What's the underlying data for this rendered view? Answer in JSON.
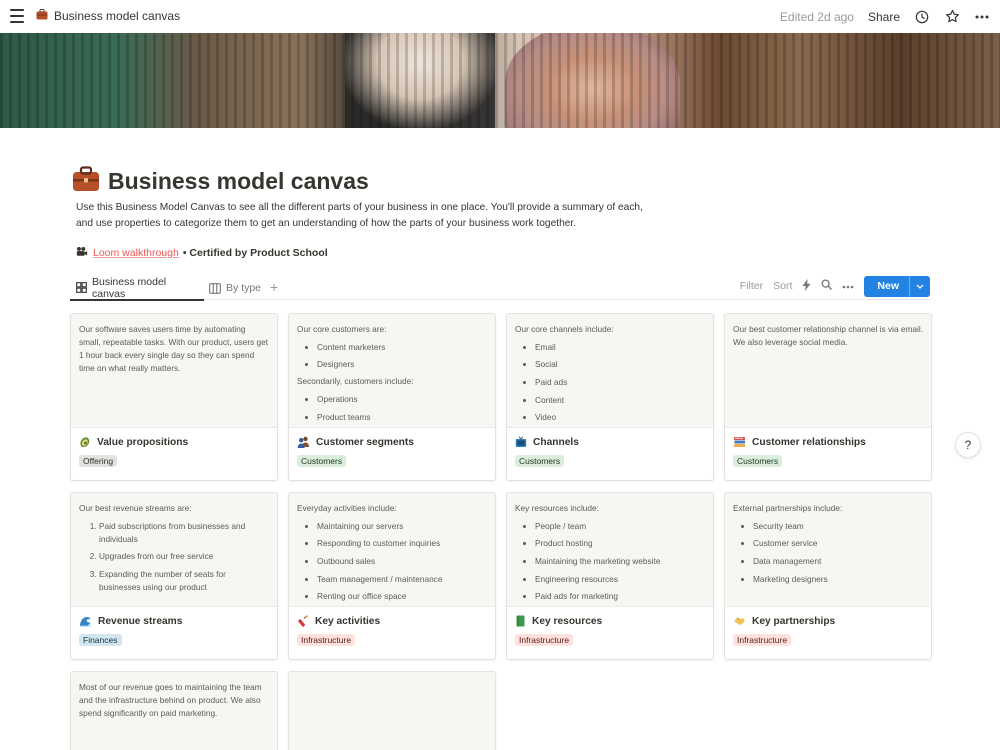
{
  "topbar": {
    "breadcrumb": "Business model canvas",
    "edited": "Edited 2d ago",
    "share": "Share"
  },
  "page": {
    "title": "Business model canvas",
    "description": "Use this Business Model Canvas to see all the different parts of your business in one place. You'll provide a summary of each, and use properties to categorize them to get an understanding of how the parts of your business work together.",
    "loom_link": "Loom walkthrough",
    "certified": "• Certified by Product School"
  },
  "views": {
    "tabs": [
      "Business model canvas",
      "By type"
    ],
    "filter": "Filter",
    "sort": "Sort",
    "new": "New"
  },
  "cards": [
    {
      "title": "Value propositions",
      "icon": "avocado-icon",
      "tag": "Offering",
      "tag_color": "gray",
      "preview": [
        {
          "type": "p",
          "text": "Our software saves users time by automating small, repeatable tasks. With our product, users get 1 hour back every single day so they can spend time on what really matters."
        }
      ]
    },
    {
      "title": "Customer segments",
      "icon": "people-icon",
      "tag": "Customers",
      "tag_color": "green",
      "preview": [
        {
          "type": "p",
          "text": "Our core customers are:"
        },
        {
          "type": "ul",
          "items": [
            "Content marketers",
            "Designers"
          ]
        },
        {
          "type": "p",
          "text": "Secondarily, customers include:"
        },
        {
          "type": "ul",
          "items": [
            "Operations",
            "Product teams"
          ]
        }
      ]
    },
    {
      "title": "Channels",
      "icon": "tv-icon",
      "tag": "Customers",
      "tag_color": "green",
      "preview": [
        {
          "type": "p",
          "text": "Our core channels include:"
        },
        {
          "type": "ul",
          "items": [
            "Email",
            "Social",
            "Paid ads",
            "Content",
            "Video"
          ]
        }
      ]
    },
    {
      "title": "Customer relationships",
      "icon": "books-icon",
      "tag": "Customers",
      "tag_color": "green",
      "preview": [
        {
          "type": "p",
          "text": "Our best customer relationship channel is via email. We also leverage social media."
        }
      ]
    },
    {
      "title": "Revenue streams",
      "icon": "wave-icon",
      "tag": "Finances",
      "tag_color": "blue",
      "preview": [
        {
          "type": "p",
          "text": "Our best revenue streams are:"
        },
        {
          "type": "ol",
          "items": [
            "Paid subscriptions from businesses and individuals",
            "Upgrades from our free service",
            "Expanding the number of seats for businesses using our product"
          ]
        }
      ]
    },
    {
      "title": "Key activities",
      "icon": "firecracker-icon",
      "tag": "Infrastructure",
      "tag_color": "red",
      "preview": [
        {
          "type": "p",
          "text": "Everyday activities include:"
        },
        {
          "type": "ul",
          "items": [
            "Maintaining our servers",
            "Responding to customer inquiries",
            "Outbound sales",
            "Team management / maintenance",
            "Renting our office space"
          ]
        }
      ]
    },
    {
      "title": "Key resources",
      "icon": "book-icon",
      "tag": "Infrastructure",
      "tag_color": "red",
      "preview": [
        {
          "type": "p",
          "text": "Key resources include:"
        },
        {
          "type": "ul",
          "items": [
            "People / team",
            "Product hosting",
            "Maintaining the marketing website",
            "Engineering resources",
            "Paid ads for marketing"
          ]
        }
      ]
    },
    {
      "title": "Key partnerships",
      "icon": "handshake-icon",
      "tag": "Infrastructure",
      "tag_color": "red",
      "preview": [
        {
          "type": "p",
          "text": "External partnerships include:"
        },
        {
          "type": "ul",
          "items": [
            "Security team",
            "Customer service",
            "Data management",
            "Marketing designers"
          ]
        }
      ]
    },
    {
      "title": "",
      "icon": "",
      "tag": "",
      "tag_color": "",
      "preview": [
        {
          "type": "p",
          "text": "Most of our revenue goes to maintaining the team and the infrastructure behind on product. We also spend significantly on paid marketing."
        }
      ]
    },
    {
      "title": "",
      "icon": "",
      "tag": "",
      "tag_color": "",
      "preview": []
    }
  ],
  "help": "?"
}
